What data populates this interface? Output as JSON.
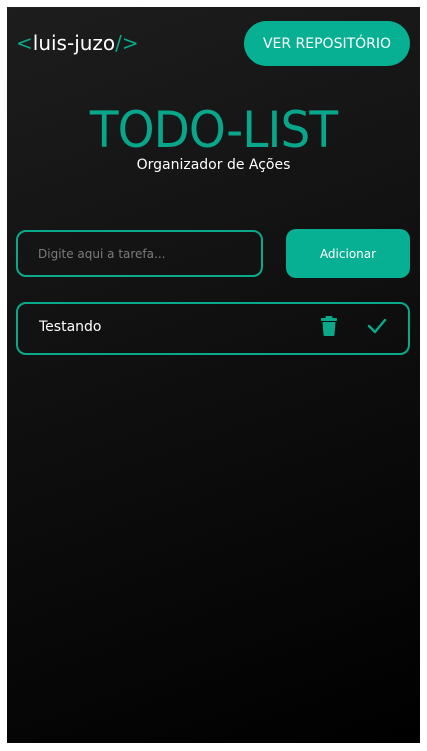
{
  "header": {
    "logo_open": "<",
    "logo_name": "luis-juzo",
    "logo_close": "/>",
    "repo_button_label": "VER REPOSITÓRIO"
  },
  "hero": {
    "title": "TODO-LIST",
    "subtitle": "Organizador de Ações"
  },
  "form": {
    "input_placeholder": "Digite aqui a tarefa...",
    "input_value": "",
    "add_button_label": "Adicionar"
  },
  "tasks": [
    {
      "text": "Testando",
      "delete_icon": "trash-icon",
      "complete_icon": "check-icon"
    }
  ],
  "colors": {
    "accent": "#08b093",
    "accent_dark": "#08a68a",
    "text": "#ffffff",
    "placeholder": "#7b7b7b"
  }
}
